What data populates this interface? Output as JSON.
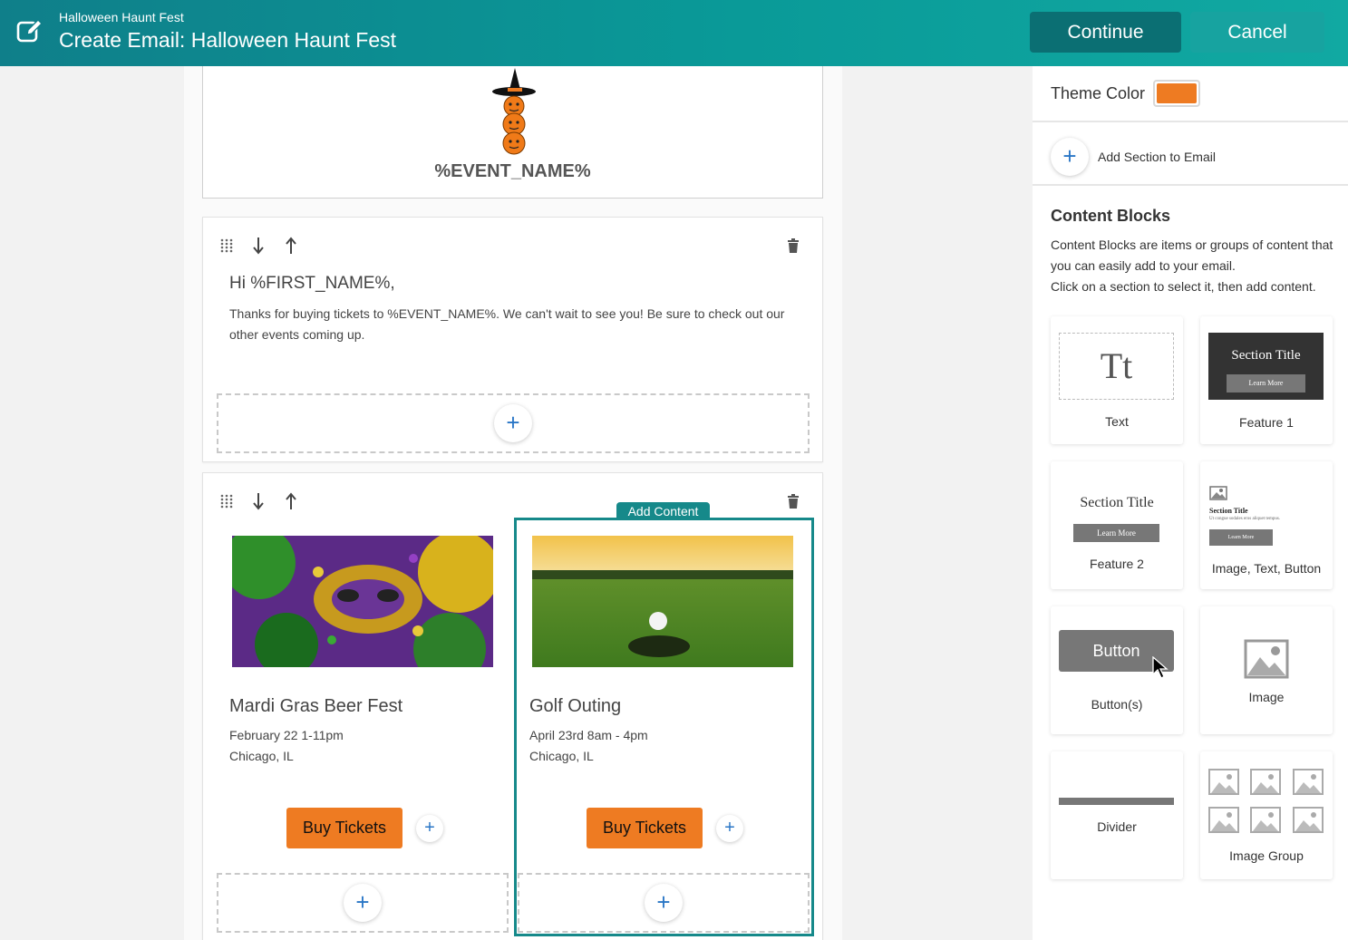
{
  "header": {
    "subtitle": "Halloween Haunt Fest",
    "title": "Create Email: Halloween Haunt Fest",
    "continue_label": "Continue",
    "cancel_label": "Cancel"
  },
  "email": {
    "event_name": "%EVENT_NAME%",
    "greeting": "Hi %FIRST_NAME%,",
    "message": "Thanks for buying tickets to %EVENT_NAME%. We can't wait to see you! Be sure to check out our other events coming up.",
    "add_content_label": "Add Content",
    "events": [
      {
        "title": "Mardi Gras Beer Fest",
        "date": "February 22 1-11pm",
        "location": "Chicago, IL",
        "button": "Buy Tickets"
      },
      {
        "title": "Golf Outing",
        "date": "April 23rd 8am - 4pm",
        "location": "Chicago, IL",
        "button": "Buy Tickets"
      }
    ]
  },
  "panel": {
    "theme_label": "Theme Color",
    "theme_color": "#ee7b22",
    "add_section_label": "Add Section to Email",
    "content_blocks_title": "Content Blocks",
    "content_blocks_desc_1": "Content Blocks are items or groups of content that you can easily add to your email.",
    "content_blocks_desc_2": "Click on a section to select it, then add content.",
    "blocks": [
      {
        "label": "Text",
        "preview": "Tt"
      },
      {
        "label": "Feature 1",
        "preview_title": "Section Title",
        "preview_button": "Learn More"
      },
      {
        "label": "Feature 2",
        "preview_title": "Section Title",
        "preview_button": "Learn More"
      },
      {
        "label": "Image, Text, Button",
        "preview_title": "Section Title",
        "preview_text": "Ut congue sodales eros aliquet tempus.",
        "preview_button": "Learn More"
      },
      {
        "label": "Button(s)",
        "preview": "Button"
      },
      {
        "label": "Image"
      },
      {
        "label": "Divider"
      },
      {
        "label": "Image Group"
      }
    ]
  }
}
